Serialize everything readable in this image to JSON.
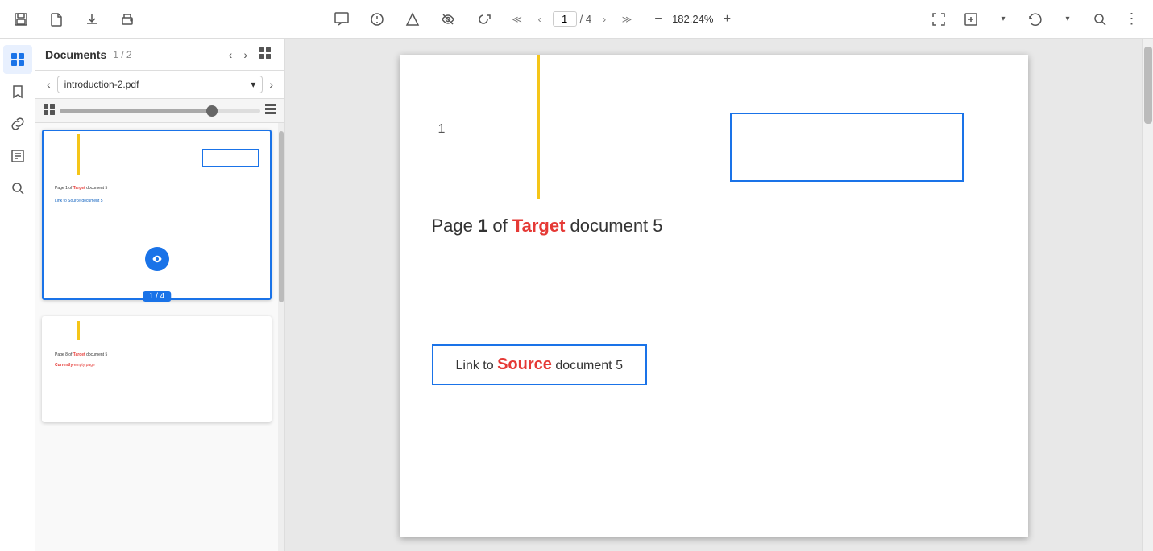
{
  "toolbar": {
    "icons": [
      "save",
      "file",
      "download",
      "print"
    ],
    "center_icons": [
      "comment",
      "annotation",
      "shape",
      "hide",
      "rotate"
    ],
    "page_current": "1",
    "page_total": "4",
    "zoom": "182.24%",
    "right_icons": [
      "fullscreen",
      "fit-page",
      "undo",
      "search",
      "more"
    ]
  },
  "sidebar": {
    "icons": [
      "grid-apps",
      "bookmark",
      "link",
      "note",
      "search"
    ]
  },
  "documents_panel": {
    "title": "Documents",
    "count": "1 / 2",
    "doc_name": "introduction-2.pdf",
    "thumbnail1": {
      "page_label": "1 / 4",
      "line1": "Page 1 of Target document 5",
      "line2": "Link to Source document 5",
      "active": true
    },
    "thumbnail2": {
      "line1": "Page 8 of Target document 5",
      "line2": "Currently empty page"
    }
  },
  "main_content": {
    "page_number": "1",
    "page_title_prefix": "Page ",
    "page_title_num": "1",
    "page_title_of": " of ",
    "target_word": "Target",
    "page_title_suffix": " document 5",
    "link_box": {
      "prefix": "Link to ",
      "source_word": "Source",
      "suffix": " document 5"
    }
  }
}
